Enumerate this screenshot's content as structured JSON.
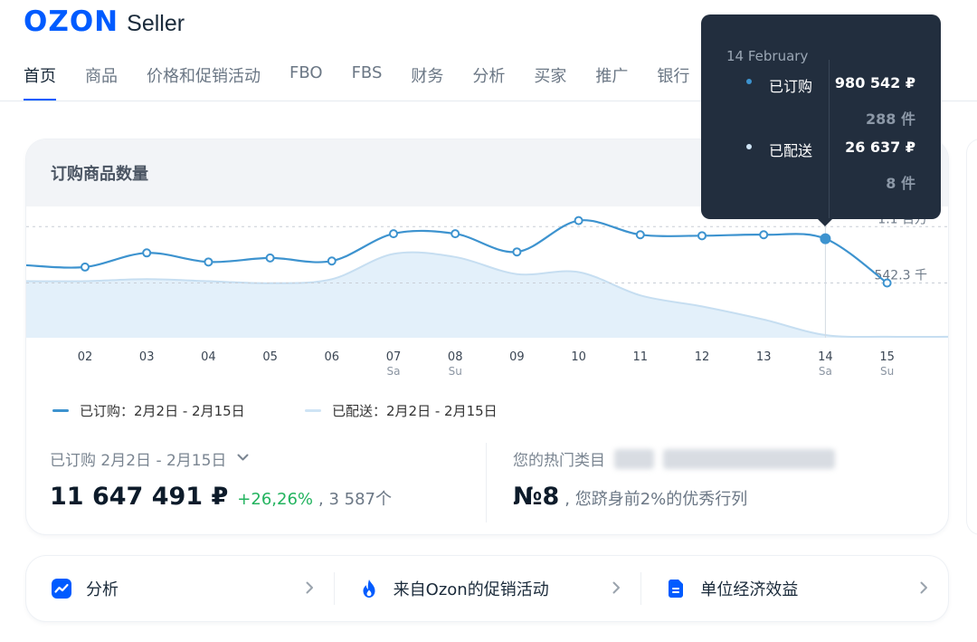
{
  "header": {
    "logo_text": "OZON",
    "logo_sub": "Seller"
  },
  "nav": {
    "items": [
      {
        "label": "首页",
        "active": true
      },
      {
        "label": "商品"
      },
      {
        "label": "价格和促销活动"
      },
      {
        "label": "FBO"
      },
      {
        "label": "FBS"
      },
      {
        "label": "财务"
      },
      {
        "label": "分析"
      },
      {
        "label": "买家"
      },
      {
        "label": "推广"
      },
      {
        "label": "银行"
      }
    ]
  },
  "card": {
    "title": "订购商品数量"
  },
  "chart_data": {
    "type": "line",
    "x": [
      "02",
      "03",
      "04",
      "05",
      "06",
      "07",
      "08",
      "09",
      "10",
      "11",
      "12",
      "13",
      "14",
      "15"
    ],
    "x_sublabels": [
      "",
      "",
      "",
      "",
      "",
      "Sa",
      "Su",
      "",
      "",
      "",
      "",
      "",
      "Sa",
      "Su"
    ],
    "series": [
      {
        "name": "已订购：2月2日 - 2月15日",
        "color": "#3d93cf",
        "values": [
          700000,
          840000,
          750000,
          790000,
          760000,
          1030000,
          1030000,
          850000,
          1160000,
          1020000,
          1010000,
          1020000,
          980542,
          542300
        ]
      },
      {
        "name": "已配送：2月2日 - 2月15日",
        "color": "#cfe4f5",
        "values": [
          560000,
          580000,
          560000,
          540000,
          580000,
          830000,
          800000,
          630000,
          650000,
          420000,
          310000,
          180000,
          26637,
          10000
        ]
      }
    ],
    "gridlines": [
      {
        "value": 1100000,
        "label": "1.1 百万"
      },
      {
        "value": 542300,
        "label": "542.3 千"
      }
    ],
    "ylim": [
      0,
      1300000
    ],
    "highlight_index": 12,
    "grid": "dashed reference lines"
  },
  "legend": {
    "ordered": "已订购：2月2日 - 2月15日",
    "delivered": "已配送：2月2日 - 2月15日"
  },
  "stats": {
    "period_label": "已订购 2月2日 - 2月15日",
    "total": "11 647 491 ₽",
    "change": "+26,26%",
    "count": ", 3 587个",
    "category_label": "您的热门类目",
    "rank": "№8",
    "rank_text": ", 您跻身前2%的优秀行列"
  },
  "tooltip": {
    "date": "14 February",
    "ordered_label": "已订购",
    "ordered_value": "980 542 ₽",
    "ordered_qty": "288 件",
    "delivered_label": "已配送",
    "delivered_value": "26 637 ₽",
    "delivered_qty": "8 件"
  },
  "links": [
    {
      "label": "分析",
      "icon": "chart-icon"
    },
    {
      "label": "来自Ozon的促销活动",
      "icon": "fire-icon"
    },
    {
      "label": "单位经济效益",
      "icon": "document-icon"
    }
  ],
  "colors": {
    "brand": "#005bff",
    "positive": "#22b35e",
    "tooltip_bg": "#222e3e"
  }
}
